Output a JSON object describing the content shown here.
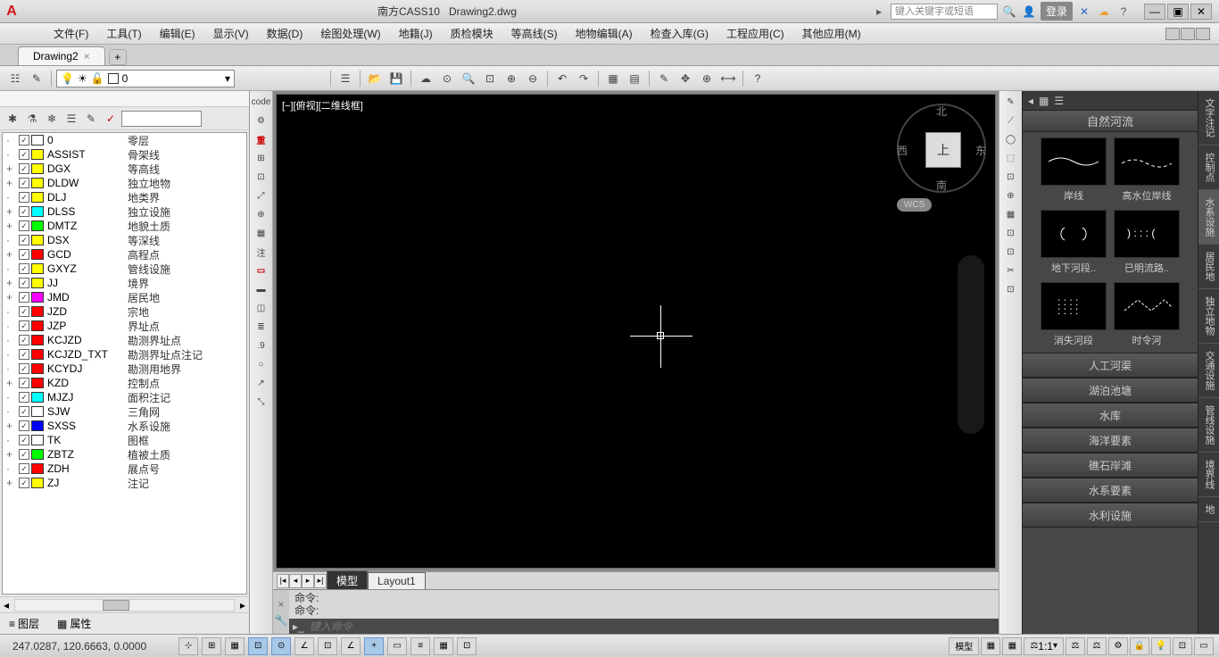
{
  "title": {
    "app": "南方CASS10",
    "file": "Drawing2.dwg"
  },
  "search": {
    "placeholder": "键入关键字或短语",
    "login": "登录"
  },
  "menu": [
    "文件(F)",
    "工具(T)",
    "编辑(E)",
    "显示(V)",
    "数据(D)",
    "绘图处理(W)",
    "地籍(J)",
    "质检模块",
    "等高线(S)",
    "地物编辑(A)",
    "检查入库(G)",
    "工程应用(C)",
    "其他应用(M)"
  ],
  "tab": {
    "name": "Drawing2"
  },
  "layerCombo": "0",
  "layers": [
    {
      "c": "#ffffff",
      "n": "0",
      "d": "零层",
      "e": ""
    },
    {
      "c": "#ffff00",
      "n": "ASSIST",
      "d": "骨架线",
      "e": ""
    },
    {
      "c": "#ffff00",
      "n": "DGX",
      "d": "等高线",
      "e": "+"
    },
    {
      "c": "#ffff00",
      "n": "DLDW",
      "d": "独立地物",
      "e": "+"
    },
    {
      "c": "#ffff00",
      "n": "DLJ",
      "d": "地类界",
      "e": ""
    },
    {
      "c": "#00ffff",
      "n": "DLSS",
      "d": "独立设施",
      "e": "+"
    },
    {
      "c": "#00ff00",
      "n": "DMTZ",
      "d": "地貌土质",
      "e": "+"
    },
    {
      "c": "#ffff00",
      "n": "DSX",
      "d": "等深线",
      "e": ""
    },
    {
      "c": "#ff0000",
      "n": "GCD",
      "d": "高程点",
      "e": "+"
    },
    {
      "c": "#ffff00",
      "n": "GXYZ",
      "d": "管线设施",
      "e": ""
    },
    {
      "c": "#ffff00",
      "n": "JJ",
      "d": "境界",
      "e": "+"
    },
    {
      "c": "#ff00ff",
      "n": "JMD",
      "d": "居民地",
      "e": "+"
    },
    {
      "c": "#ff0000",
      "n": "JZD",
      "d": "宗地",
      "e": ""
    },
    {
      "c": "#ff0000",
      "n": "JZP",
      "d": "界址点",
      "e": ""
    },
    {
      "c": "#ff0000",
      "n": "KCJZD",
      "d": "勘测界址点",
      "e": ""
    },
    {
      "c": "#ff0000",
      "n": "KCJZD_TXT",
      "d": "勘测界址点注记",
      "e": ""
    },
    {
      "c": "#ff0000",
      "n": "KCYDJ",
      "d": "勘测用地界",
      "e": ""
    },
    {
      "c": "#ff0000",
      "n": "KZD",
      "d": "控制点",
      "e": "+"
    },
    {
      "c": "#00ffff",
      "n": "MJZJ",
      "d": "面积注记",
      "e": ""
    },
    {
      "c": "#ffffff",
      "n": "SJW",
      "d": "三角网",
      "e": ""
    },
    {
      "c": "#0000ff",
      "n": "SXSS",
      "d": "水系设施",
      "e": "+"
    },
    {
      "c": "#ffffff",
      "n": "TK",
      "d": "图框",
      "e": ""
    },
    {
      "c": "#00ff00",
      "n": "ZBTZ",
      "d": "植被土质",
      "e": "+"
    },
    {
      "c": "#ff0000",
      "n": "ZDH",
      "d": "展点号",
      "e": ""
    },
    {
      "c": "#ffff00",
      "n": "ZJ",
      "d": "注记",
      "e": "+"
    }
  ],
  "leftTabs": {
    "layer": "图层",
    "prop": "属性"
  },
  "viewport": {
    "label": "[−][俯视][二维线框]"
  },
  "viewcube": {
    "n": "北",
    "s": "南",
    "e": "东",
    "w": "西",
    "top": "上",
    "wcs": "WCS"
  },
  "spaceTabs": {
    "model": "模型",
    "layout": "Layout1"
  },
  "cmd": {
    "h1": "命令:",
    "h2": "命令:",
    "placeholder": "键入命令"
  },
  "leftVT": [
    "code",
    "⚙",
    "重",
    "⊞",
    "⊡",
    "⤢",
    "⊕",
    "▦",
    "注",
    "▭",
    "▬",
    "◫",
    "≣",
    ".9",
    "○",
    "↗",
    "⤡"
  ],
  "rightVT": [
    "✎",
    "⟋",
    "◯",
    "⬚",
    "⊡",
    "⊕",
    "▦",
    "⊡",
    "⊡",
    "✂",
    "⊡"
  ],
  "rp": {
    "title": "自然河流",
    "items": [
      {
        "label": "岸线",
        "svg": "wave"
      },
      {
        "label": "高水位岸线",
        "svg": "dashwave"
      },
      {
        "label": "地下河段..",
        "svg": "moons"
      },
      {
        "label": "已明流路..",
        "svg": "dots2"
      },
      {
        "label": "消失河段",
        "svg": "dotsgrid"
      },
      {
        "label": "时令河",
        "svg": "dashwave2"
      }
    ],
    "cats": [
      "人工河渠",
      "湖泊池塘",
      "水库",
      "海洋要素",
      "礁石岸滩",
      "水系要素",
      "水利设施"
    ]
  },
  "sideTabs": [
    "文字注记",
    "控制点",
    "水系设施",
    "居民地",
    "独立地物",
    "交通设施",
    "管线设施",
    "境界线",
    "地"
  ],
  "status": {
    "coords": "247.0287, 120.6663, 0.0000",
    "model": "模型",
    "scale": "1:1"
  }
}
